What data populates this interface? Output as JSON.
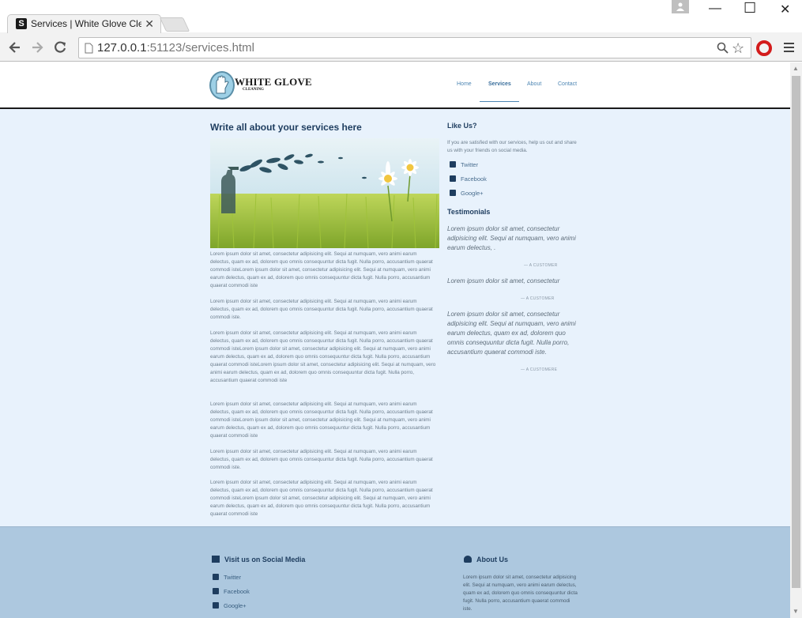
{
  "browser": {
    "tab_title": "Services | White Glove Cle",
    "tab_favicon": "S",
    "url_host": "127.0.0.1",
    "url_path": ":51123/services.html",
    "icons": [
      "back-icon",
      "forward-icon",
      "reload-icon",
      "page-icon",
      "zoom-icon",
      "star-icon",
      "opera-icon",
      "menu-icon",
      "profile-icon",
      "minimize-icon",
      "maximize-icon",
      "close-icon"
    ]
  },
  "site": {
    "logo_text": "WHITE GLOVE",
    "logo_sub": "CLEANING",
    "nav": [
      {
        "label": "Home"
      },
      {
        "label": "Services"
      },
      {
        "label": "About"
      },
      {
        "label": "Contact"
      }
    ],
    "active_nav": "Services",
    "main_title": "Write all about your services here",
    "paragraphs": [
      "Lorem ipsum dolor sit amet, consectetur adipisicing elit. Sequi at numquam, vero animi earum delectus, quam ex ad, dolorem quo omnis consequuntur dicta fugit. Nulla porro, accusantium quaerat commodi isteLorem ipsum dolor sit amet, consectetur adipisicing elit. Sequi at numquam, vero animi earum delectus, quam ex ad, dolorem quo omnis consequuntur dicta fugit. Nulla porro, accusantium quaerat commodi iste",
      "Lorem ipsum dolor sit amet, consectetur adipisicing elit. Sequi at numquam, vero animi earum delectus, quam ex ad, dolorem quo omnis consequuntur dicta fugit. Nulla porro, accusantium quaerat commodi iste.",
      "Lorem ipsum dolor sit amet, consectetur adipisicing elit. Sequi at numquam, vero animi earum delectus, quam ex ad, dolorem quo omnis consequuntur dicta fugit. Nulla porro, accusantium quaerat commodi isteLorem ipsum dolor sit amet, consectetur adipisicing elit. Sequi at numquam, vero animi earum delectus, quam ex ad, dolorem quo omnis consequuntur dicta fugit. Nulla porro, accusantium quaerat commodi isteLorem ipsum dolor sit amet, consectetur adipisicing elit. Sequi at numquam, vero animi earum delectus, quam ex ad, dolorem quo omnis consequuntur dicta fugit. Nulla porro, accusantium quaerat commodi iste",
      "Lorem ipsum dolor sit amet, consectetur adipisicing elit. Sequi at numquam, vero animi earum delectus, quam ex ad, dolorem quo omnis consequuntur dicta fugit. Nulla porro, accusantium quaerat commodi isteLorem ipsum dolor sit amet, consectetur adipisicing elit. Sequi at numquam, vero animi earum delectus, quam ex ad, dolorem quo omnis consequuntur dicta fugit. Nulla porro, accusantium quaerat commodi iste",
      "Lorem ipsum dolor sit amet, consectetur adipisicing elit. Sequi at numquam, vero animi earum delectus, quam ex ad, dolorem quo omnis consequuntur dicta fugit. Nulla porro, accusantium quaerat commodi iste.",
      "Lorem ipsum dolor sit amet, consectetur adipisicing elit. Sequi at numquam, vero animi earum delectus, quam ex ad, dolorem quo omnis consequuntur dicta fugit. Nulla porro, accusantium quaerat commodi isteLorem ipsum dolor sit amet, consectetur adipisicing elit. Sequi at numquam, vero animi earum delectus, quam ex ad, dolorem quo omnis consequuntur dicta fugit. Nulla porro, accusantium quaerat commodi iste"
    ],
    "sidebar": {
      "like_title": "Like Us?",
      "like_text": "If you are satisfied with our services, help us out and share us with your friends on social media.",
      "social": [
        {
          "label": "Twitter",
          "icon": "twitter-icon"
        },
        {
          "label": "Facebook",
          "icon": "facebook-icon"
        },
        {
          "label": "Google+",
          "icon": "google-plus-icon"
        }
      ],
      "testimonials_title": "Testimonials",
      "testimonials": [
        {
          "quote": "Lorem ipsum dolor sit amet, consectetur adipisicing elit. Sequi at numquam, vero animi earum delectus, .",
          "cite": "— A CUSTOMER"
        },
        {
          "quote": "Lorem ipsum dolor sit amet, consectetur",
          "cite": "— A CUSTOMER"
        },
        {
          "quote": "Lorem ipsum dolor sit amet, consectetur adipisicing elit. Sequi at numquam, vero animi earum delectus, quam ex ad, dolorem quo omnis consequuntur dicta fugit. Nulla porro, accusantium quaerat commodi iste.",
          "cite": "— A CUSTOMERE"
        }
      ]
    },
    "footer": {
      "social_title": "Visit us on Social Media",
      "social": [
        {
          "label": "Twitter"
        },
        {
          "label": "Facebook"
        },
        {
          "label": "Google+"
        }
      ],
      "about_title": "About Us",
      "about_text": "Lorem ipsum dolor sit amet, consectetur adipisicing elit. Sequi at numquam, vero animi earum delectus, quam ex ad, dolorem quo omnis consequuntur dicta fugit. Nulla porro, accusantium quaerat commodi iste."
    },
    "colors": {
      "page_bg": "#e8f2fc",
      "footer_bg": "#adc8df",
      "heading": "#1e3d5f",
      "nav_link": "#4d86b3"
    }
  }
}
